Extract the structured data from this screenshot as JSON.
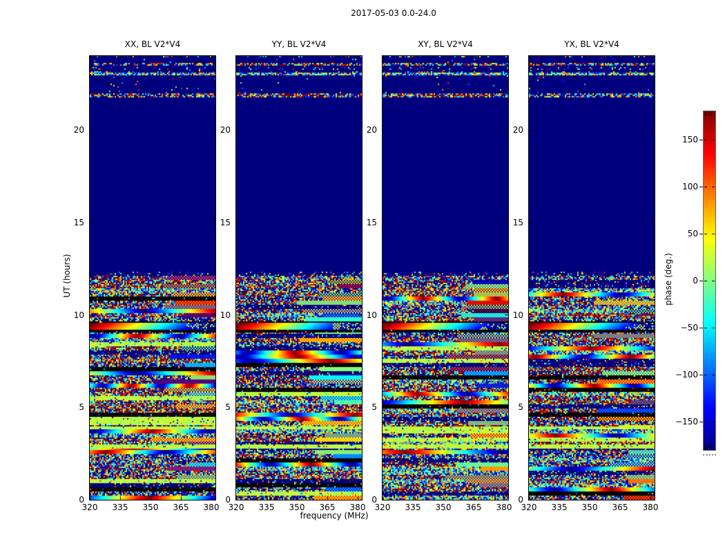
{
  "figure": {
    "title": "2017-05-03 0.0-24.0",
    "background": "#ffffff"
  },
  "chart_data": {
    "type": "heatmap",
    "title": "2017-05-03 0.0-24.0",
    "xlabel": "frequency (MHz)",
    "ylabel": "UT (hours)",
    "x_ticks": [
      320,
      335,
      350,
      365,
      380
    ],
    "y_ticks": [
      0,
      5,
      10,
      15,
      20
    ],
    "x_range_mhz": [
      320,
      384
    ],
    "y_range_hours": [
      0,
      24
    ],
    "panels": [
      {
        "label": "XX, BL V2*V4",
        "seed": 11
      },
      {
        "label": "YY, BL V2*V4",
        "seed": 23
      },
      {
        "label": "XY, BL V2*V4",
        "seed": 37
      },
      {
        "label": "YX, BL V2*V4",
        "seed": 53
      }
    ],
    "colorbar": {
      "label": "phase (deg.)",
      "ticks": [
        150,
        100,
        50,
        0,
        -50,
        -100,
        -150
      ],
      "range_deg": [
        -180,
        180
      ],
      "colormap": "jet",
      "min_color": "#000080",
      "max_color": "#800000"
    },
    "regions": [
      {
        "ut": [
          0,
          12.3
        ],
        "style": "noise",
        "note": "dense random phase speckle with horizontal banding"
      },
      {
        "ut": [
          12.3,
          21.72
        ],
        "style": "solid_min",
        "note": "uniform minimum-phase dark blue block"
      },
      {
        "ut": [
          21.72,
          24
        ],
        "style": "quiet_with_stripes",
        "note": "dark blue with thin noisy time stripes"
      }
    ],
    "top_stripes": [
      {
        "ut": [
          23.9,
          24.0
        ],
        "style": "sparse"
      },
      {
        "ut": [
          23.5,
          23.66
        ],
        "style": "speckle"
      },
      {
        "ut": [
          23.28,
          23.4
        ],
        "style": "sparse"
      },
      {
        "ut": [
          23.1,
          23.17
        ],
        "style": "sparse"
      },
      {
        "ut": [
          22.92,
          23.08
        ],
        "style": "cyan"
      },
      {
        "ut": [
          21.74,
          21.98
        ],
        "style": "speckle"
      }
    ],
    "anchors": [
      {
        "ut": [
          12.1,
          12.3
        ],
        "style": "sparse"
      },
      {
        "ut": [
          9.6,
          9.68
        ],
        "style": "black"
      },
      {
        "ut": [
          9.16,
          9.6
        ],
        "style": "fringe_main"
      },
      {
        "ut": [
          9.06,
          9.16
        ],
        "style": "black"
      },
      {
        "ut": [
          3.84,
          3.96
        ],
        "style": "green"
      },
      {
        "ut": [
          2.74,
          2.98
        ],
        "style": "green"
      }
    ]
  }
}
